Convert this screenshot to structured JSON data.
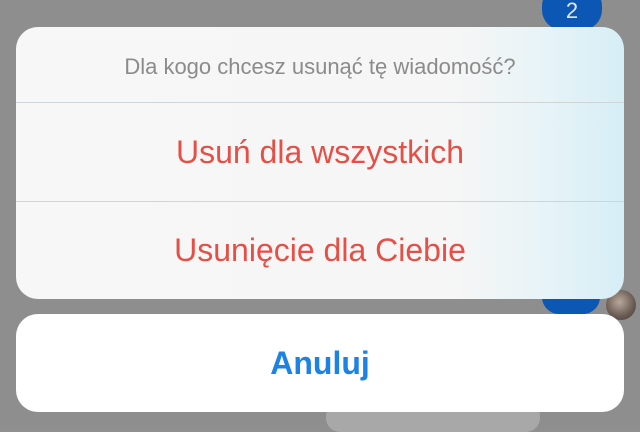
{
  "background": {
    "top_bubble_text": "2"
  },
  "sheet": {
    "title": "Dla kogo chcesz usunąć tę wiadomość?",
    "actions": [
      {
        "label": "Usuń dla wszystkich"
      },
      {
        "label": "Usunięcie dla Ciebie"
      }
    ]
  },
  "cancel": {
    "label": "Anuluj"
  },
  "colors": {
    "destructive": "#e64f45",
    "cancel": "#1b83e4",
    "chat_bubble": "#0c57b3"
  }
}
